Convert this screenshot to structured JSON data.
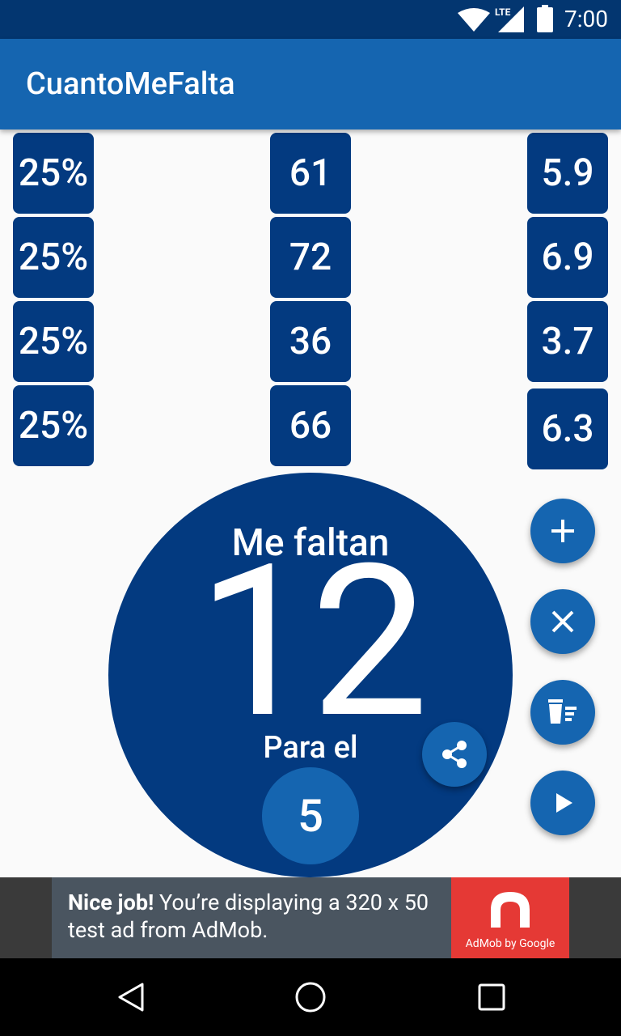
{
  "status_bar": {
    "time": "7:00",
    "network_label": "LTE",
    "icons": [
      "wifi-icon",
      "signal-icon",
      "battery-icon"
    ]
  },
  "app_bar": {
    "title": "CuantoMeFalta"
  },
  "grid": {
    "rows": [
      {
        "percent": "25%",
        "count": "61",
        "grade": "5.9"
      },
      {
        "percent": "25%",
        "count": "72",
        "grade": "6.9"
      },
      {
        "percent": "25%",
        "count": "36",
        "grade": "3.7"
      },
      {
        "percent": "25%",
        "count": "66",
        "grade": "6.3"
      }
    ]
  },
  "result": {
    "header": "Me faltan",
    "value": "12",
    "subheader": "Para el",
    "target": "5"
  },
  "fabs": [
    "plus-icon",
    "close-icon",
    "clear-all-icon",
    "play-icon",
    "share-icon"
  ],
  "ad": {
    "bold": "Nice job!",
    "text": " You’re displaying a 320 x 50 test ad from AdMob.",
    "logo_caption": "AdMob by Google"
  },
  "colors": {
    "status_bar": "#033670",
    "app_bar": "#1565b0",
    "cell": "#033a80",
    "fab": "#1565b0",
    "ad_red": "#e53935"
  }
}
